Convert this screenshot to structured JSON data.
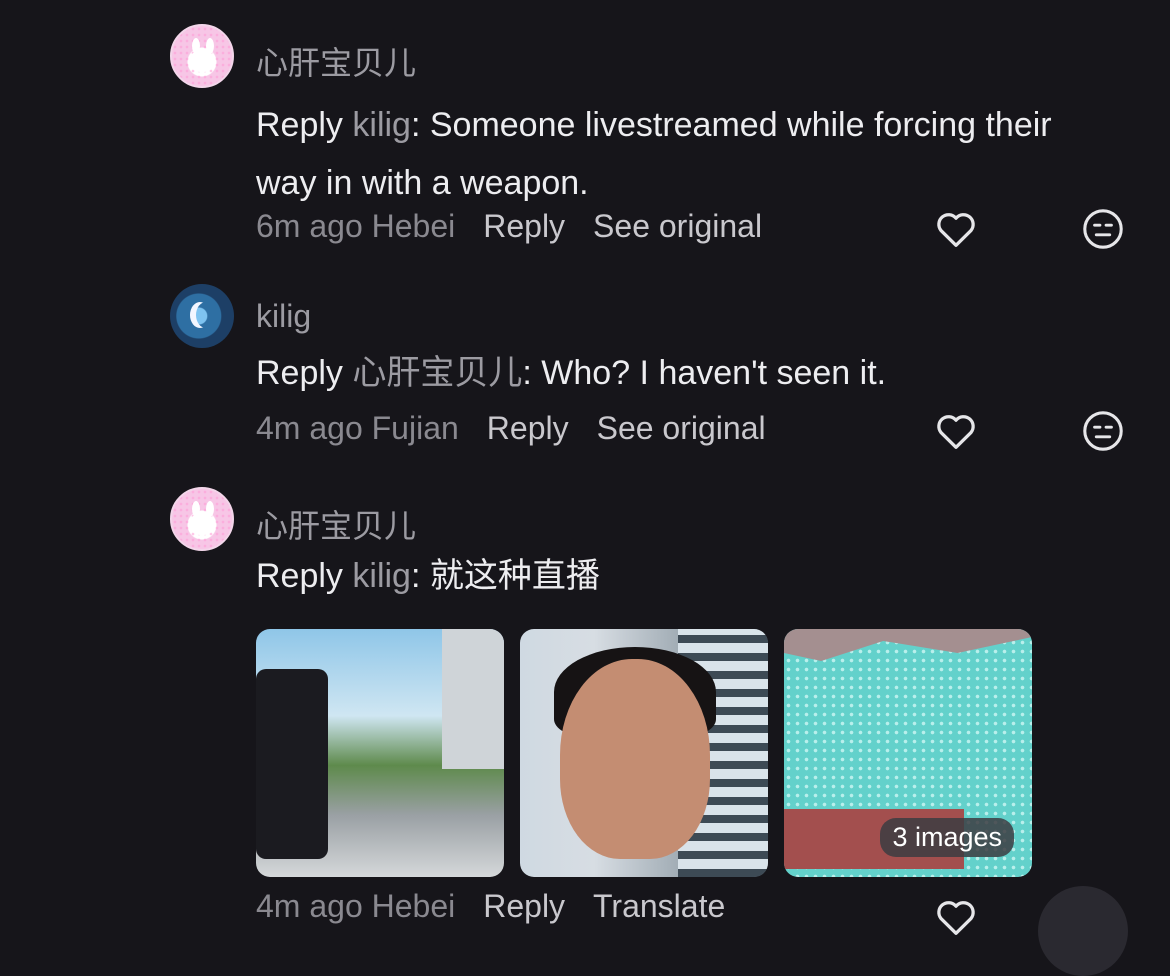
{
  "comments": [
    {
      "username": "心肝宝贝儿",
      "reply_prefix": "Reply",
      "reply_to": "kilig",
      "text": ": Someone livestreamed while forcing their way in with a weapon.",
      "time": "6m ago",
      "location": "Hebei",
      "reply_label": "Reply",
      "see_original_label": "See original",
      "avatar": "pink-bunny-avatar"
    },
    {
      "username": "kilig",
      "reply_prefix": "Reply",
      "reply_to": "心肝宝贝儿",
      "text": ": Who? I haven't seen it.",
      "time": "4m ago",
      "location": "Fujian",
      "reply_label": "Reply",
      "see_original_label": "See original",
      "avatar": "moon-avatar"
    },
    {
      "username": "心肝宝贝儿",
      "reply_prefix": "Reply",
      "reply_to": "kilig",
      "text": ": 就这种直播",
      "avatar": "pink-bunny-avatar",
      "images_badge": "3 images"
    }
  ],
  "partial_meta": {
    "time": "4m ago",
    "location": "Hebei",
    "reply_label": "Reply",
    "translate_label": "Translate"
  },
  "icons": {
    "like": "heart-outline-icon",
    "dislike": "meh-face-icon"
  }
}
